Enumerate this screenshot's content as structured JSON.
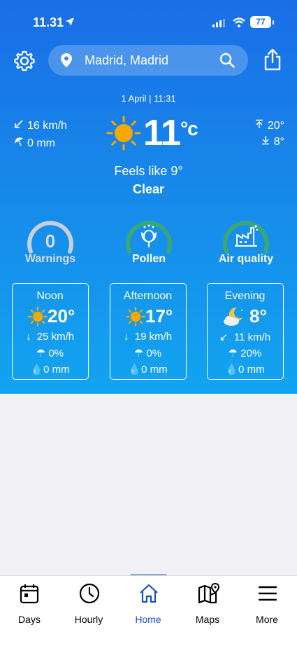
{
  "status": {
    "time": "11.31",
    "battery": "77"
  },
  "header": {
    "location": "Madrid, Madrid"
  },
  "current": {
    "datetime": "1 April | 11:31",
    "wind": "16 km/h",
    "rain": "0 mm",
    "temp": "11",
    "unit": "°c",
    "high": "20°",
    "low": "8°",
    "feels_like": "Feels like 9°",
    "condition": "Clear"
  },
  "gauges": [
    {
      "label": "Warnings",
      "value": "0"
    },
    {
      "label": "Pollen"
    },
    {
      "label": "Air quality"
    }
  ],
  "periods": [
    {
      "name": "Noon",
      "temp": "20°",
      "wind": "25 km/h",
      "precip_prob": "0%",
      "rain": "0 mm",
      "icon": "sun-icon"
    },
    {
      "name": "Afternoon",
      "temp": "17°",
      "wind": "19 km/h",
      "precip_prob": "0%",
      "rain": "0 mm",
      "icon": "sun-icon"
    },
    {
      "name": "Evening",
      "temp": "8°",
      "wind": "11 km/h",
      "precip_prob": "20%",
      "rain": "0 mm",
      "icon": "moon-cloud-icon"
    }
  ],
  "nav": [
    {
      "label": "Days"
    },
    {
      "label": "Hourly"
    },
    {
      "label": "Home"
    },
    {
      "label": "Maps"
    },
    {
      "label": "More"
    }
  ],
  "colors": {
    "accent": "#1a4fbf",
    "sun": "#f6a800",
    "gauge_green": "#3aa876",
    "gauge_grey": "#c9cfd8"
  }
}
